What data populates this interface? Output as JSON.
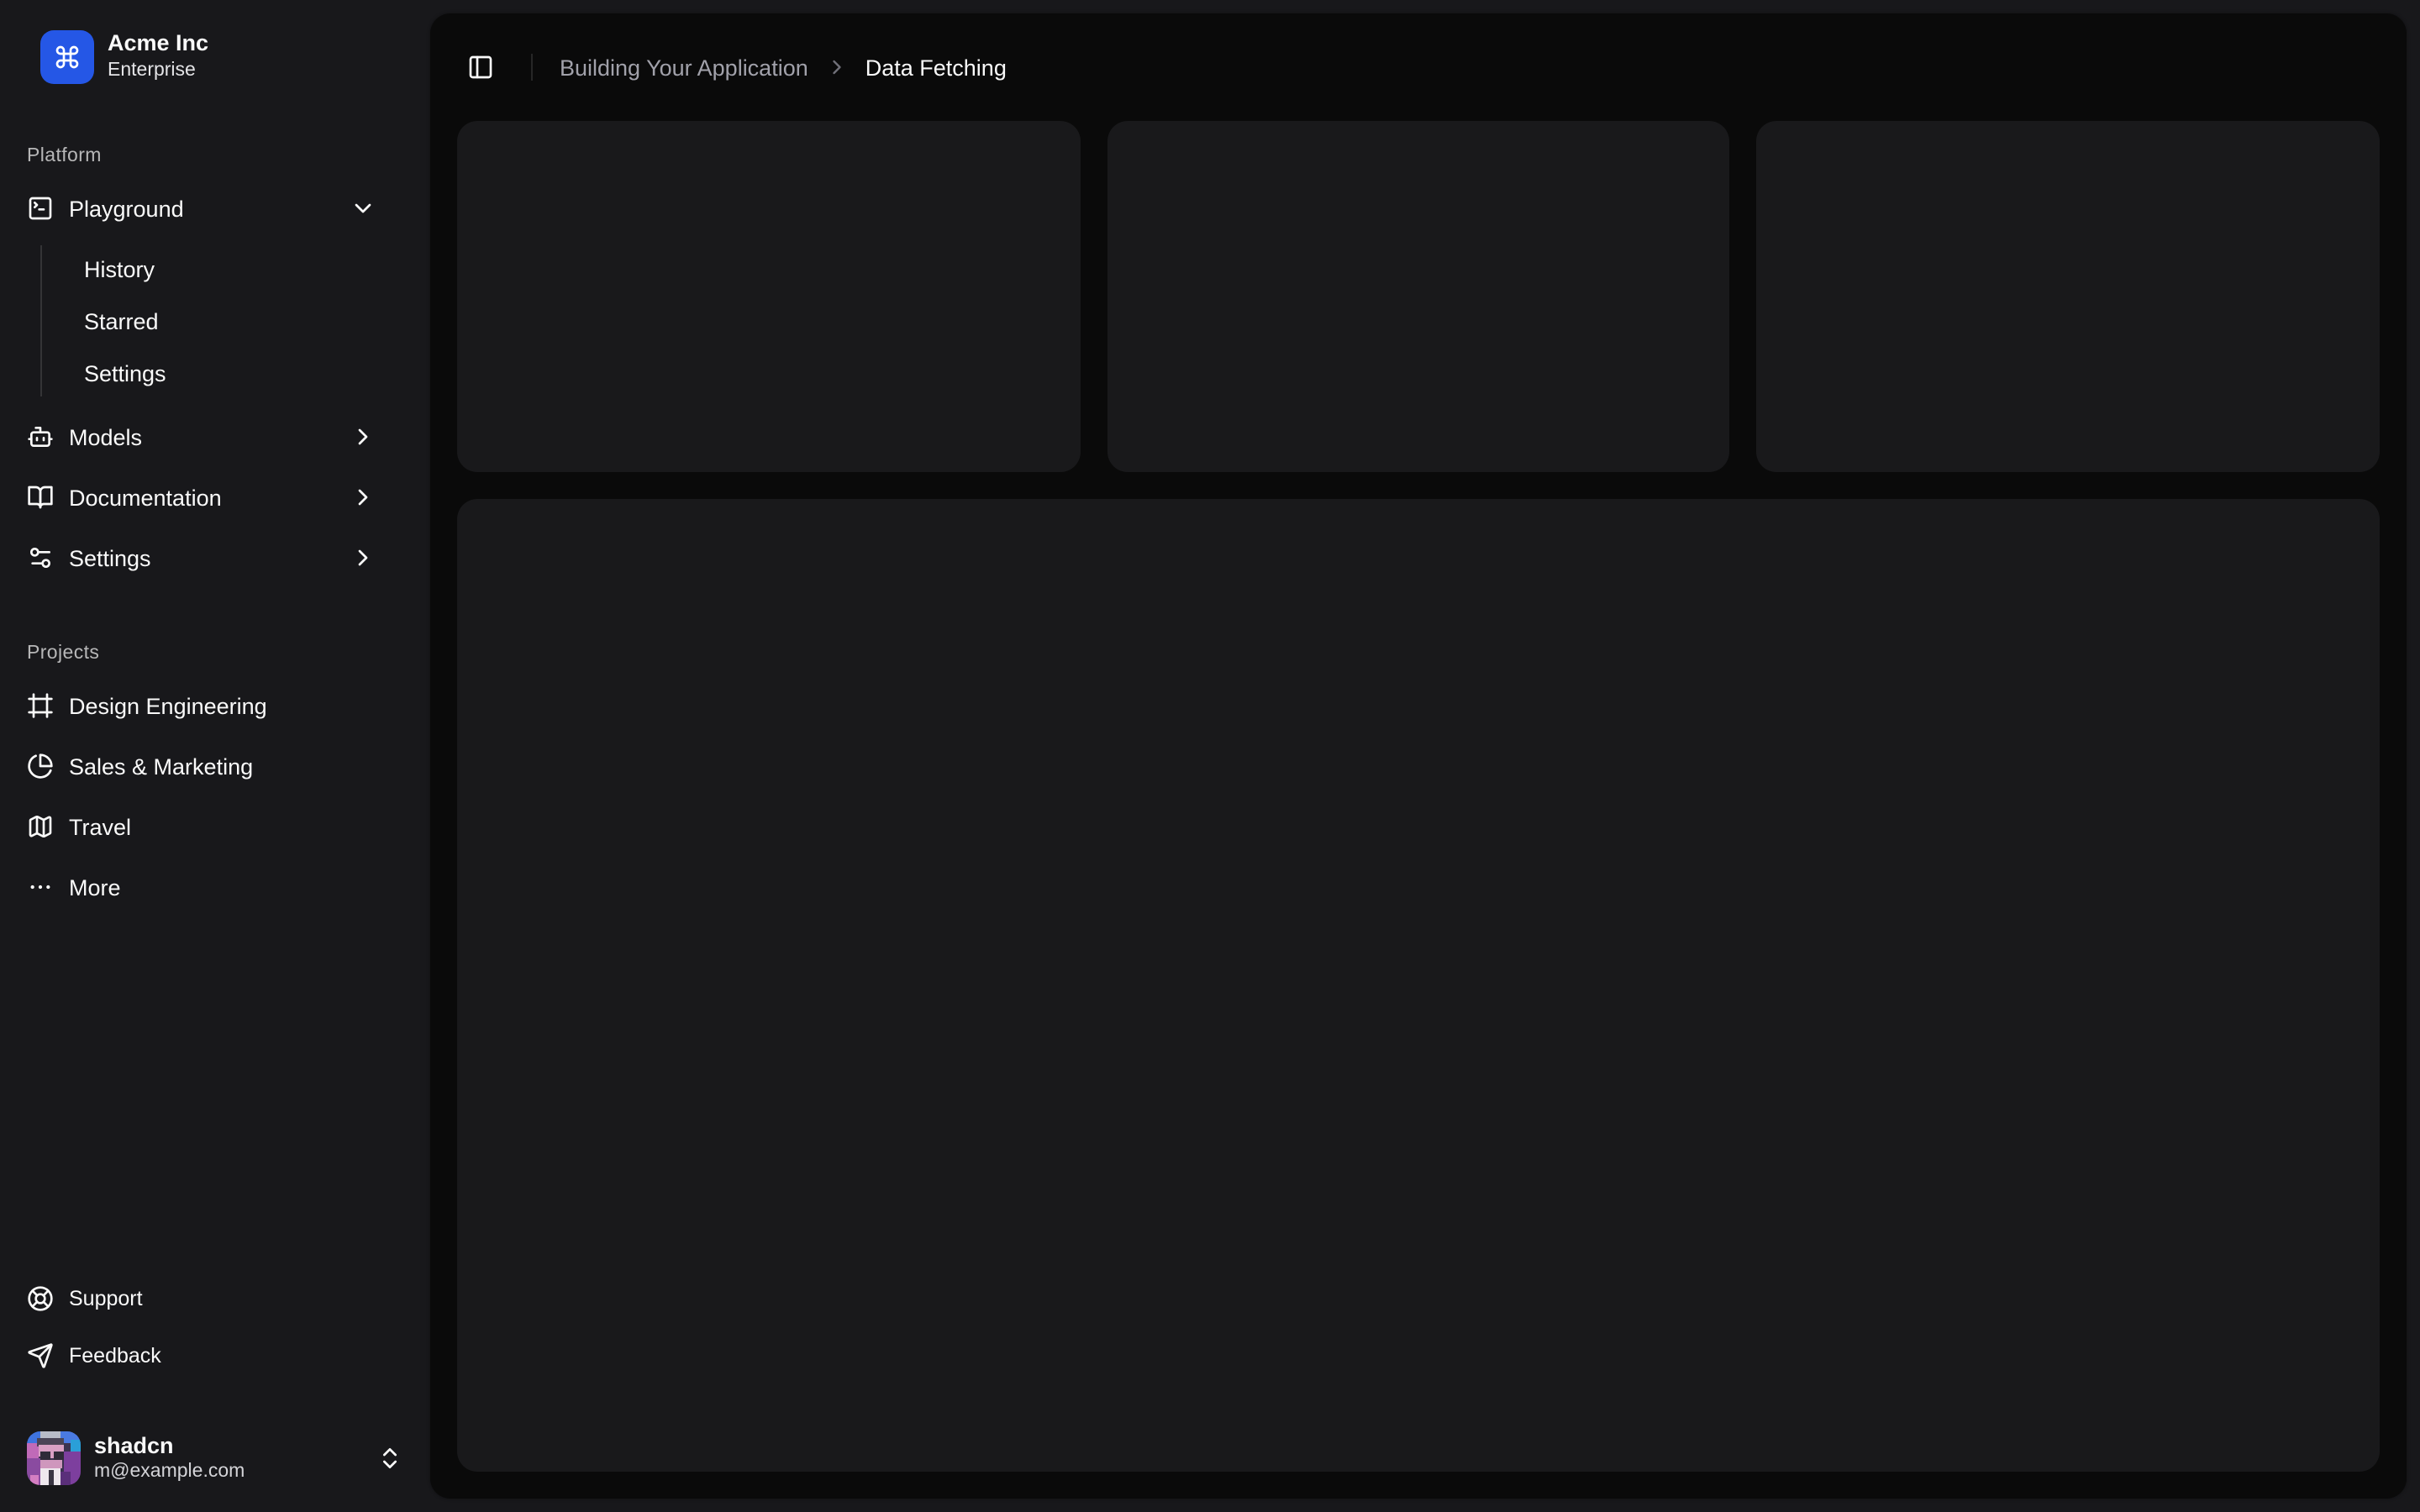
{
  "colors": {
    "page_bg": "#18181b",
    "inset_bg": "#0a0a0a",
    "card_bg": "#19191b",
    "accent_blue": "#2557e6",
    "text_primary": "#fafafa",
    "text_muted": "#a1a1aa",
    "label_muted": "rgba(250,250,250,0.7)",
    "border": "rgba(255,255,255,0.12)"
  },
  "sidebar": {
    "team": {
      "name": "Acme Inc",
      "plan": "Enterprise",
      "logo_icon": "command-icon"
    },
    "groups": [
      {
        "label": "Platform",
        "items": [
          {
            "label": "Playground",
            "icon": "square-terminal-icon",
            "expanded": true,
            "children": [
              {
                "label": "History"
              },
              {
                "label": "Starred"
              },
              {
                "label": "Settings"
              }
            ]
          },
          {
            "label": "Models",
            "icon": "bot-icon"
          },
          {
            "label": "Documentation",
            "icon": "book-open-icon"
          },
          {
            "label": "Settings",
            "icon": "settings-icon"
          }
        ]
      },
      {
        "label": "Projects",
        "items": [
          {
            "label": "Design Engineering",
            "icon": "frame-icon"
          },
          {
            "label": "Sales & Marketing",
            "icon": "pie-chart-icon"
          },
          {
            "label": "Travel",
            "icon": "map-icon"
          },
          {
            "label": "More",
            "icon": "ellipsis-icon"
          }
        ]
      }
    ],
    "secondary": [
      {
        "label": "Support",
        "icon": "life-buoy-icon"
      },
      {
        "label": "Feedback",
        "icon": "send-icon"
      }
    ],
    "user": {
      "name": "shadcn",
      "email": "m@example.com"
    }
  },
  "header": {
    "breadcrumb": {
      "parent": "Building Your Application",
      "current": "Data Fetching"
    }
  },
  "main": {
    "placeholder_card_count": 3
  }
}
